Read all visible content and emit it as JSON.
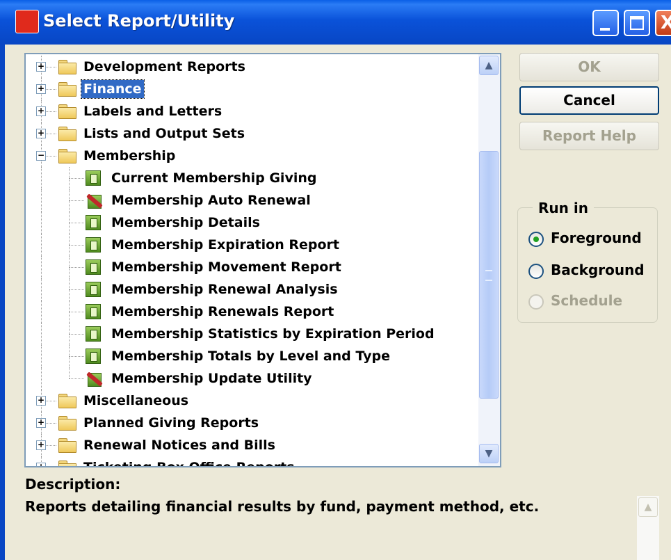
{
  "window": {
    "title": "Select Report/Utility",
    "icon": "app-logo-icon"
  },
  "tree": {
    "items": [
      {
        "label": "Development Reports",
        "type": "folder",
        "level": 0,
        "expanded": false,
        "selected": false
      },
      {
        "label": "Finance",
        "type": "folder",
        "level": 0,
        "expanded": false,
        "selected": true
      },
      {
        "label": "Labels and Letters",
        "type": "folder",
        "level": 0,
        "expanded": false,
        "selected": false
      },
      {
        "label": "Lists and Output Sets",
        "type": "folder",
        "level": 0,
        "expanded": false,
        "selected": false
      },
      {
        "label": "Membership",
        "type": "folder",
        "level": 0,
        "expanded": true,
        "selected": false
      },
      {
        "label": "Current Membership Giving",
        "type": "report",
        "level": 1
      },
      {
        "label": "Membership Auto Renewal",
        "type": "utility",
        "level": 1
      },
      {
        "label": "Membership Details",
        "type": "report",
        "level": 1
      },
      {
        "label": "Membership Expiration Report",
        "type": "report",
        "level": 1
      },
      {
        "label": "Membership Movement Report",
        "type": "report",
        "level": 1
      },
      {
        "label": "Membership Renewal Analysis",
        "type": "report",
        "level": 1
      },
      {
        "label": "Membership Renewals Report",
        "type": "report",
        "level": 1
      },
      {
        "label": "Membership Statistics by Expiration Period",
        "type": "report",
        "level": 1
      },
      {
        "label": "Membership Totals by Level and Type",
        "type": "report",
        "level": 1
      },
      {
        "label": "Membership Update Utility",
        "type": "utility",
        "level": 1
      },
      {
        "label": "Miscellaneous",
        "type": "folder",
        "level": 0,
        "expanded": false,
        "selected": false
      },
      {
        "label": "Planned Giving Reports",
        "type": "folder",
        "level": 0,
        "expanded": false,
        "selected": false
      },
      {
        "label": "Renewal Notices and Bills",
        "type": "folder",
        "level": 0,
        "expanded": false,
        "selected": false
      },
      {
        "label": "Ticketing Box Office Reports",
        "type": "folder",
        "level": 0,
        "expanded": false,
        "selected": false
      }
    ]
  },
  "buttons": {
    "ok": "OK",
    "cancel": "Cancel",
    "report_help": "Report Help"
  },
  "run_in": {
    "legend": "Run in",
    "options": [
      {
        "label": "Foreground",
        "checked": true,
        "enabled": true
      },
      {
        "label": "Background",
        "checked": false,
        "enabled": true
      },
      {
        "label": "Schedule",
        "checked": false,
        "enabled": false
      }
    ]
  },
  "description": {
    "label": "Description:",
    "text": "Reports detailing financial results by fund, payment method, etc."
  }
}
